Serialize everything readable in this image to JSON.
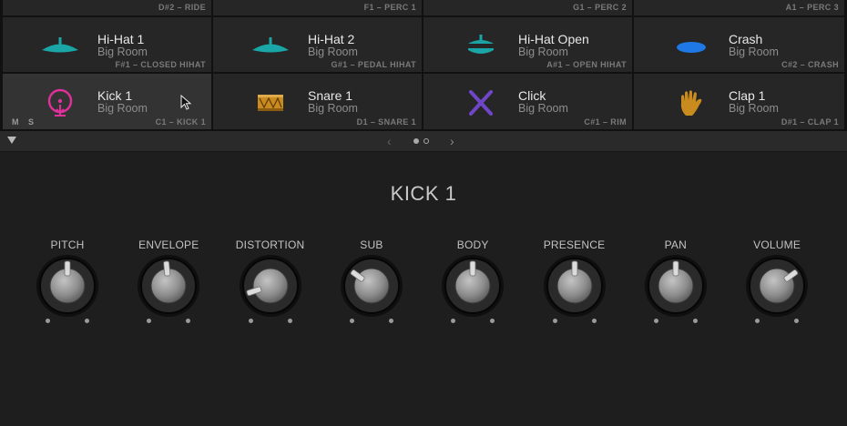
{
  "colors": {
    "cyan": "#1aa6a6",
    "blue": "#1e78e6",
    "magenta": "#e0309a",
    "gold": "#c98b1e",
    "purple": "#7046c8",
    "knob_dark": "#141414",
    "knob_face": "#9a9a9a"
  },
  "partial_row": [
    {
      "note": "D#2 – RIDE"
    },
    {
      "note": "F1 – PERC 1"
    },
    {
      "note": "G1 – PERC 2"
    },
    {
      "note": "A1 – PERC 3"
    }
  ],
  "pads_row1": [
    {
      "name": "Hi-Hat 1",
      "kit": "Big Room",
      "note": "F#1 – CLOSED HIHAT",
      "icon": "cymbal-icon"
    },
    {
      "name": "Hi-Hat 2",
      "kit": "Big Room",
      "note": "G#1 – PEDAL HIHAT",
      "icon": "cymbal-icon"
    },
    {
      "name": "Hi-Hat Open",
      "kit": "Big Room",
      "note": "A#1 – OPEN HIHAT",
      "icon": "open-hihat-icon"
    },
    {
      "name": "Crash",
      "kit": "Big Room",
      "note": "C#2 – CRASH",
      "icon": "crash-cymbal-icon"
    }
  ],
  "pads_row2": [
    {
      "name": "Kick 1",
      "kit": "Big Room",
      "note": "C1 – KICK 1",
      "icon": "kick-drum-icon",
      "selected": true
    },
    {
      "name": "Snare 1",
      "kit": "Big Room",
      "note": "D1 – SNARE 1",
      "icon": "snare-drum-icon"
    },
    {
      "name": "Click",
      "kit": "Big Room",
      "note": "C#1 – RIM",
      "icon": "drumsticks-icon"
    },
    {
      "name": "Clap 1",
      "kit": "Big Room",
      "note": "D#1 – CLAP 1",
      "icon": "clap-hand-icon"
    }
  ],
  "pad_mute_label": "M",
  "pad_solo_label": "S",
  "pager": {
    "prev_glyph": "‹",
    "next_glyph": "›",
    "current_page": 1,
    "total_pages": 2
  },
  "editor": {
    "title": "KICK 1",
    "knobs": [
      {
        "label": "PITCH",
        "value": 0.5
      },
      {
        "label": "ENVELOPE",
        "value": 0.48
      },
      {
        "label": "DISTORTION",
        "value": 0.1
      },
      {
        "label": "SUB",
        "value": 0.3
      },
      {
        "label": "BODY",
        "value": 0.5
      },
      {
        "label": "PRESENCE",
        "value": 0.5
      },
      {
        "label": "PAN",
        "value": 0.5
      },
      {
        "label": "VOLUME",
        "value": 0.7
      }
    ]
  }
}
